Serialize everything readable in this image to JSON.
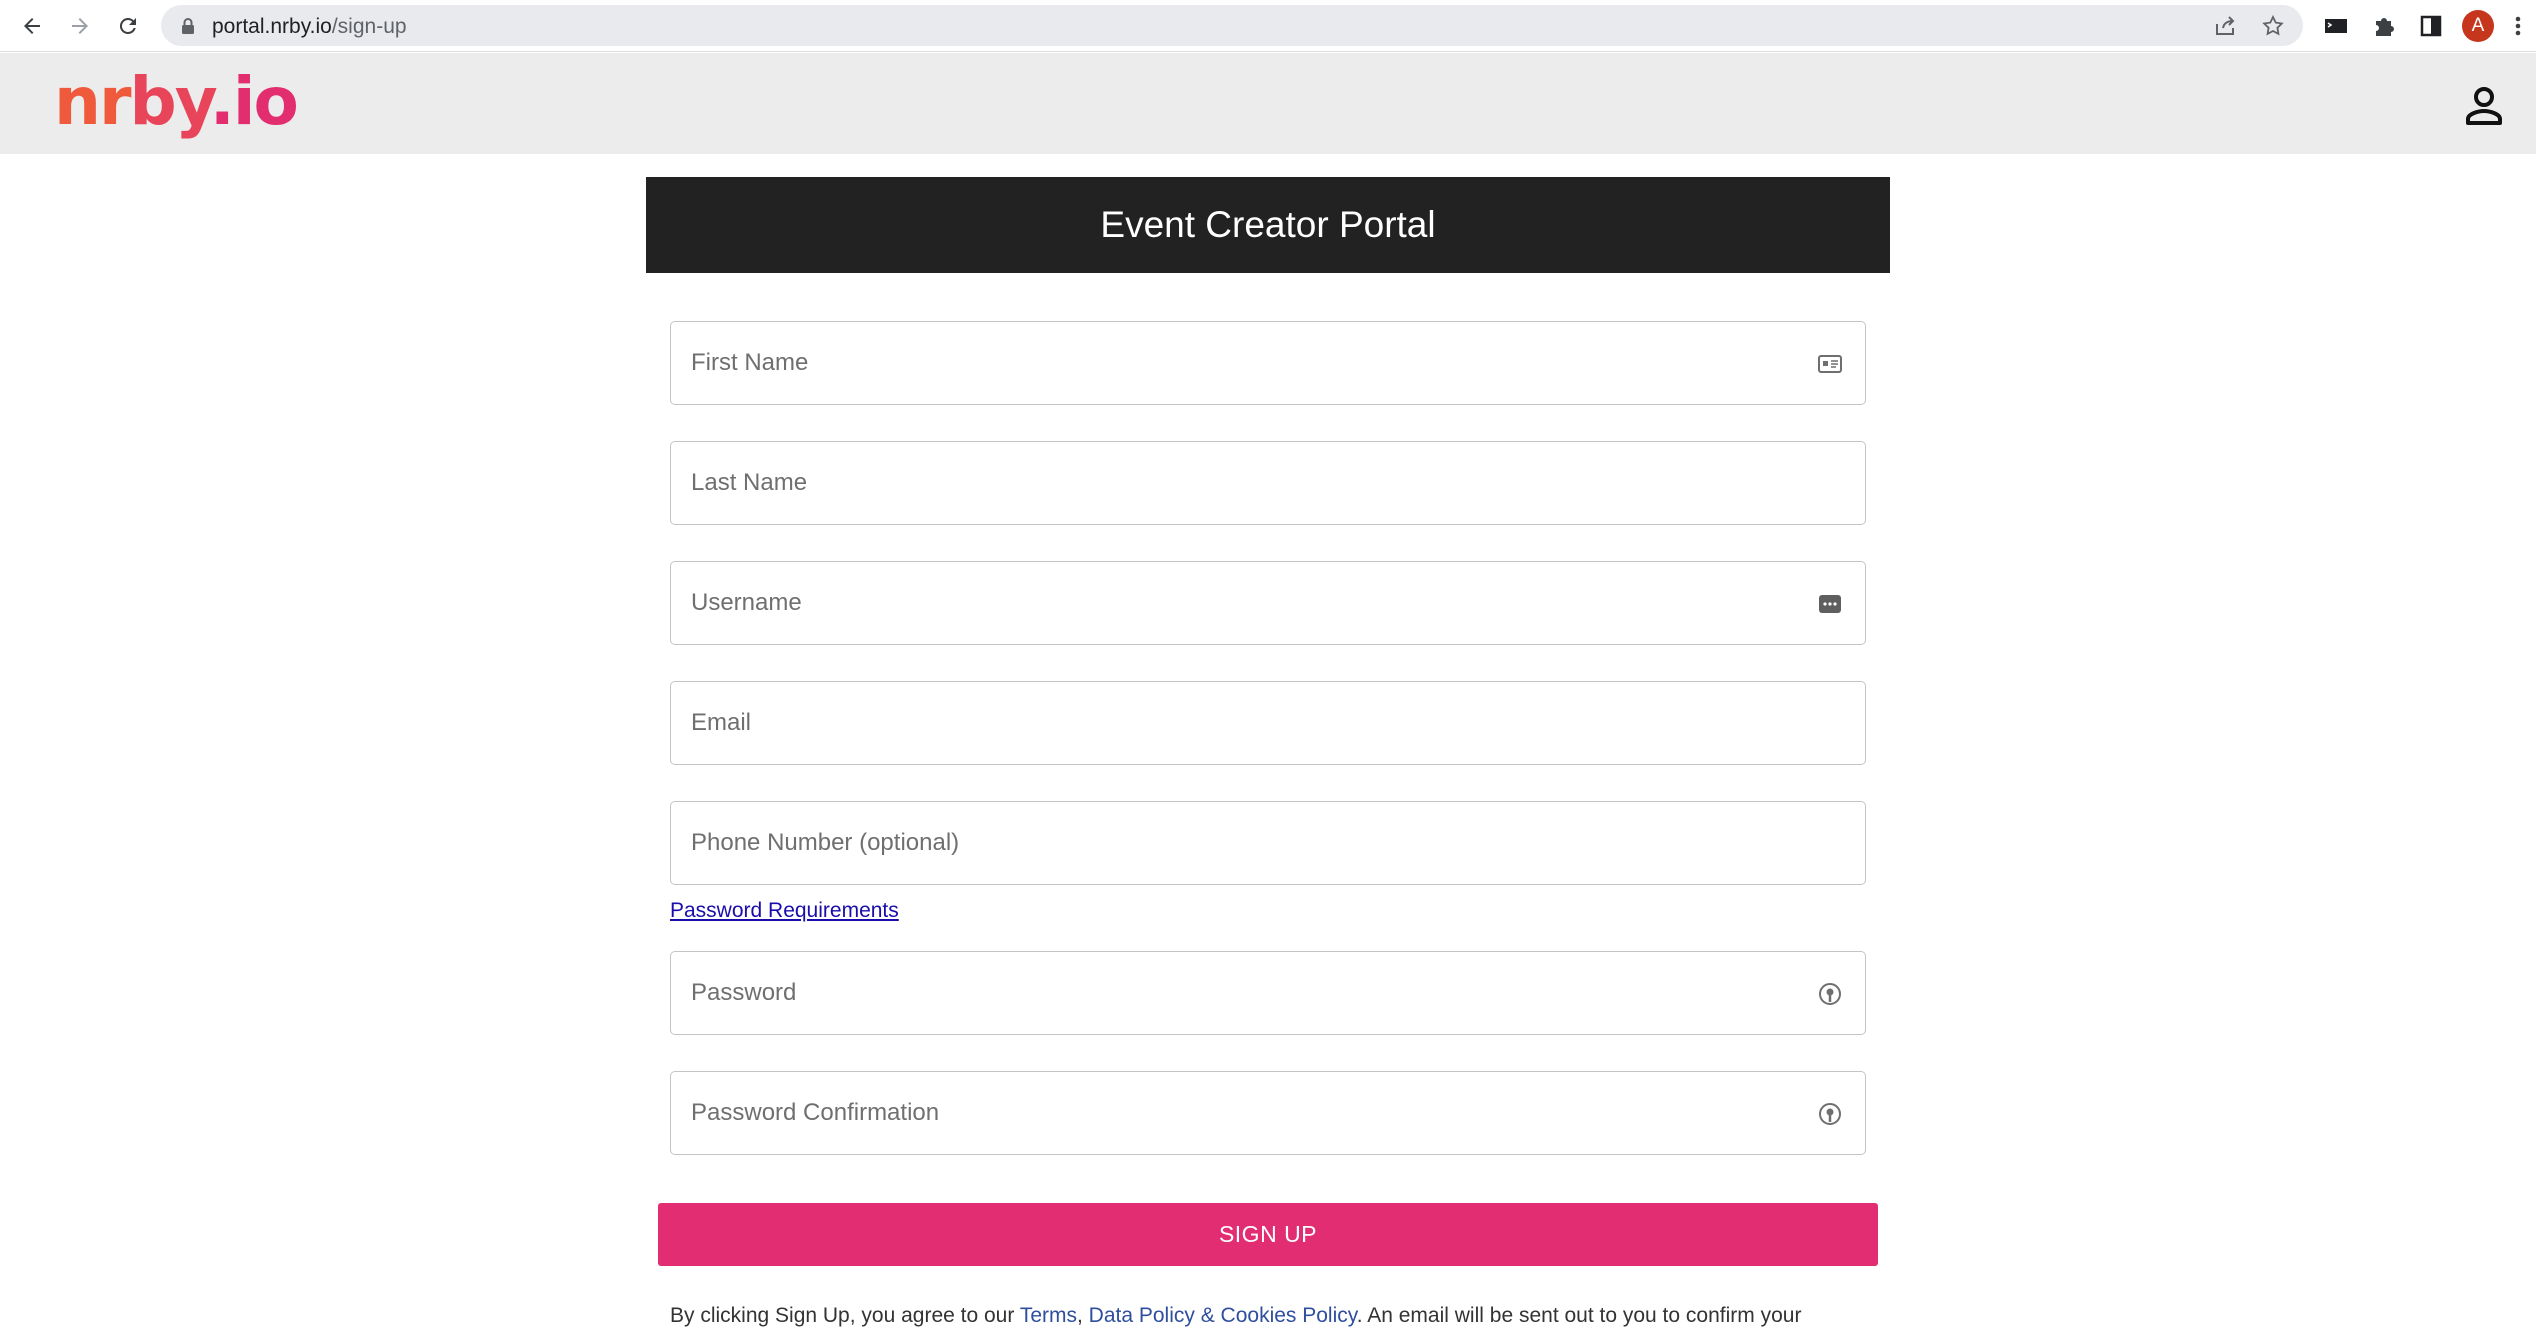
{
  "browser": {
    "url_host": "portal.nrby.io",
    "url_path": "/sign-up",
    "profile_initial": "A",
    "profile_color": "#c5361d"
  },
  "header": {
    "logo_part_1": "nr",
    "logo_part_2": "by",
    "logo_part_3": ".io",
    "logo_colors": [
      "#ef5a3d",
      "#e9455a",
      "#e22d6e"
    ],
    "user_icon": "person-outline-icon"
  },
  "banner": {
    "title": "Event Creator Portal"
  },
  "form": {
    "first_name_placeholder": "First Name",
    "last_name_placeholder": "Last Name",
    "username_placeholder": "Username",
    "email_placeholder": "Email",
    "phone_placeholder": "Phone Number (optional)",
    "password_requirements_link": "Password Requirements",
    "password_placeholder": "Password",
    "password_confirmation_placeholder": "Password Confirmation",
    "signup_button": "SIGN UP"
  },
  "legal": {
    "prefix": "By clicking Sign Up, you agree to our ",
    "terms_link": "Terms",
    "separator": ", ",
    "data_policy_link": "Data Policy & Cookies Policy",
    "suffix": ". An email will be sent out to you to confirm your"
  },
  "colors": {
    "accent": "#e22d73",
    "banner_bg": "#222222",
    "appbar_bg": "#ececec",
    "link": "#1a0dab"
  }
}
